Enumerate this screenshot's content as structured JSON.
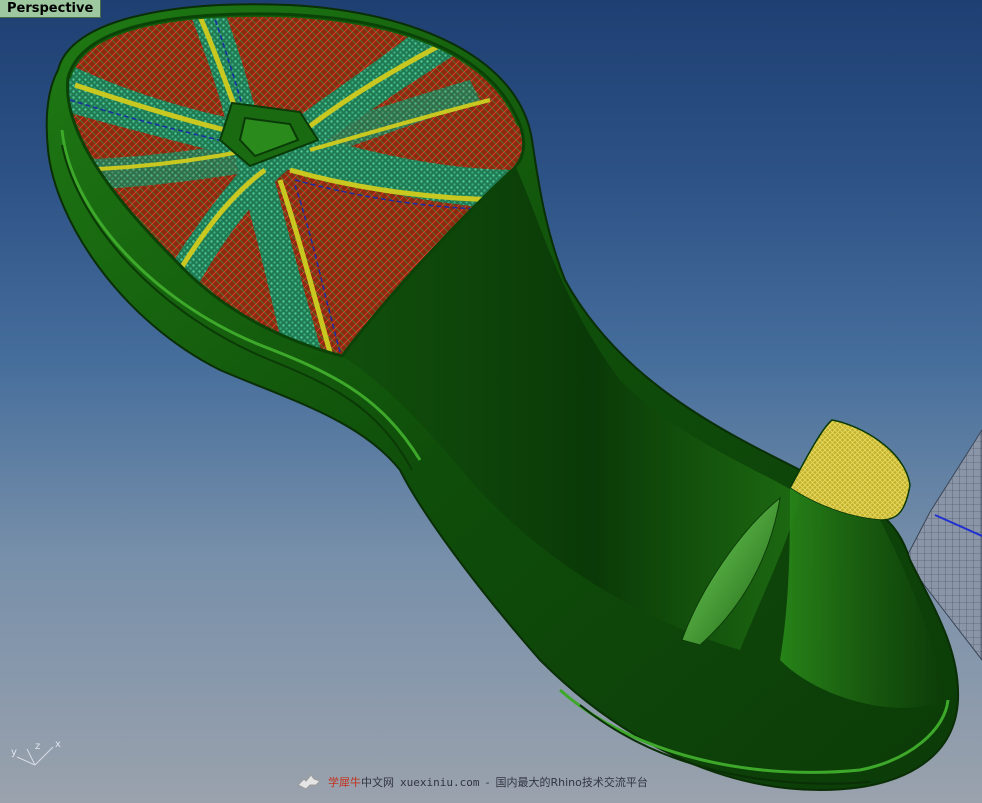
{
  "viewport": {
    "label": "Perspective",
    "axes": {
      "x": "x",
      "y": "y",
      "z": "z"
    }
  },
  "watermark": {
    "brand_red": "学犀牛",
    "brand_rest": "中文网",
    "url": "xuexiniu.com",
    "separator": "-",
    "tagline": "国内最大的Rhino技术交流平台"
  },
  "colors": {
    "sole_green": "#1d6a12",
    "tread_red": "#8a2a10",
    "tread_teal": "#2a8a62",
    "stripe_yellow": "#c8c820",
    "heel_cap_yellow": "#d4c43a"
  },
  "icons": [
    "world-axes-icon",
    "rhino-logo-icon"
  ]
}
